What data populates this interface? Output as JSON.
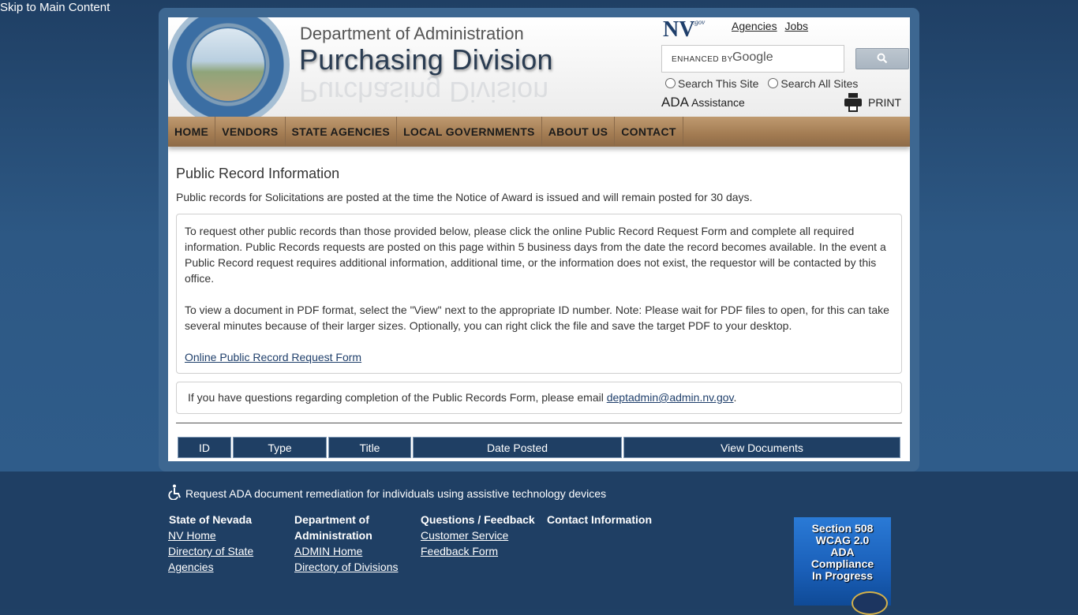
{
  "skip_link": "Skip to Main Content",
  "header": {
    "department": "Department of Administration",
    "division": "Purchasing Division",
    "nv_logo": "NV",
    "nv_gov": ".gov",
    "top_links": [
      "Agencies",
      "Jobs"
    ],
    "search": {
      "enhanced_by": "ENHANCED BY",
      "google": "Google",
      "button_icon": "search-icon"
    },
    "radio_options": [
      "Search This Site",
      "Search All Sites"
    ],
    "ada_label": "ADA",
    "ada_assistance": "Assistance",
    "print_label": "PRINT"
  },
  "nav": [
    "HOME",
    "VENDORS",
    "STATE AGENCIES",
    "LOCAL GOVERNMENTS",
    "ABOUT US",
    "CONTACT"
  ],
  "main": {
    "title": "Public Record Information",
    "intro": "Public records for Solicitations are posted at the time the Notice of Award is issued and will remain posted for 30 days.",
    "para1": "To request other public records than those provided below, please click the online Public Record Request Form and complete all required information. Public Records requests are posted on this page within 5 business days from the date the record becomes available. In the event a Public Record request requires additional information, additional time, or the information does not exist, the requestor will be contacted by this office.",
    "para2": "To view a document in PDF format, select the \"View\" next to the appropriate ID number. Note: Please wait for PDF files to open, for this can take several minutes because of their larger sizes. Optionally, you can right click the file and save the target PDF to your desktop.",
    "form_link": "Online Public Record Request Form",
    "questions_text": "If you have questions regarding completion of the Public Records Form, please email",
    "email": "deptadmin@admin.nv.gov",
    "email_suffix": ".",
    "table_headers": [
      "ID",
      "Type",
      "Title",
      "Date Posted",
      "View Documents"
    ]
  },
  "footer": {
    "ada_request": "Request ADA document remediation for individuals using assistive technology devices",
    "col1": {
      "heading": "State of Nevada",
      "links": [
        "NV Home",
        "Directory of State",
        "Agencies"
      ]
    },
    "col2": {
      "heading1": "Department of",
      "heading2": "Administration",
      "links": [
        "ADMIN Home",
        "Directory of Divisions"
      ]
    },
    "col3": {
      "heading": "Questions / Feedback",
      "links": [
        "Customer Service",
        "Feedback Form"
      ]
    },
    "col4": {
      "heading": "Contact Information"
    },
    "badge": [
      "Section 508",
      "WCAG 2.0",
      "ADA",
      "Compliance",
      "In Progress"
    ]
  }
}
